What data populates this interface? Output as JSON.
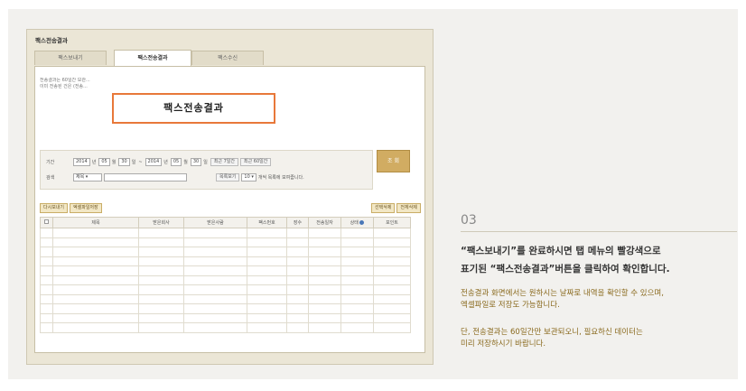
{
  "screenshot": {
    "title": "팩스전송결과",
    "tabs": [
      {
        "label": "팩스보내기",
        "state": "inactive"
      },
      {
        "label": "팩스전송결과",
        "state": "active"
      },
      {
        "label": "팩스수신",
        "state": "inactive"
      }
    ],
    "notice": [
      "전송결과는 60일간 보관...",
      "이미 전송된 건은 (전송..."
    ],
    "callout_label": "팩스전송결과",
    "filter": {
      "period_label": "기간",
      "from": {
        "year": "2014",
        "month": "05",
        "day": "30"
      },
      "to": {
        "year": "2014",
        "month": "05",
        "day": "30"
      },
      "year_unit": "년",
      "month_unit": "월",
      "day_unit": "일",
      "range_sep": "~",
      "quick_buttons": [
        "최근 7일간",
        "최근 60일간"
      ],
      "search_label": "검색",
      "search_field": "제목",
      "per_page_label": "목록보기",
      "per_page_value": "10",
      "per_page_suffix": "개씩 목록에 보여줍니다.",
      "search_button": "조 회"
    },
    "actions_left": [
      "다시보내기",
      "엑셀파일저장"
    ],
    "actions_right": [
      "선택삭제",
      "전체삭제"
    ],
    "table_headers": [
      "",
      "제목",
      "받은회사",
      "받은사람",
      "팩스번호",
      "장수",
      "전송일자",
      "상태",
      "포인트"
    ]
  },
  "description": {
    "step": "03",
    "heading_line1": "“팩스보내기”를 완료하시면 탭 메뉴의 빨강색으로",
    "heading_line2": "표기된 “팩스전송결과”버튼을 클릭하여 확인합니다.",
    "para1_line1": "전송결과 화면에서는 원하시는 날짜로 내역을 확인할 수 있으며,",
    "para1_line2": "엑셀파일로 저장도 가능합니다.",
    "para2_line1": "단, 전송결과는 60일간만 보관되오니, 필요하신 데이터는",
    "para2_line2": "미리 저장하시기 바랍니다."
  },
  "colors": {
    "callout_border": "#e8783a",
    "search_button": "#d1ac62",
    "description_text": "#8a6a1e"
  }
}
